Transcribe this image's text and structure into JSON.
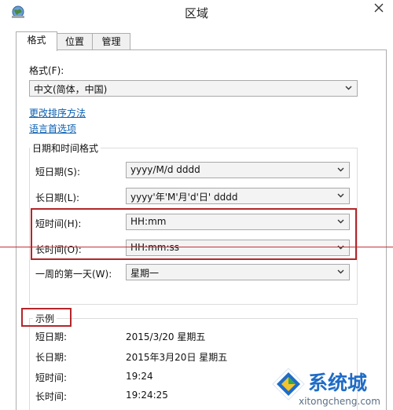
{
  "window": {
    "title": "区域"
  },
  "tabs": [
    {
      "label": "格式",
      "active": true
    },
    {
      "label": "位置",
      "active": false
    },
    {
      "label": "管理",
      "active": false
    }
  ],
  "format": {
    "label": "格式(F):",
    "value": "中文(简体，中国)"
  },
  "links": {
    "sort": "更改排序方法",
    "lang": "语言首选项"
  },
  "datetime": {
    "title": "日期和时间格式",
    "rows": [
      {
        "label": "短日期(S):",
        "value": "yyyy/M/d dddd"
      },
      {
        "label": "长日期(L):",
        "value": "yyyy'年'M'月'd'日' dddd"
      },
      {
        "label": "短时间(H):",
        "value": "HH:mm"
      },
      {
        "label": "长时间(O):",
        "value": "HH:mm:ss"
      },
      {
        "label": "一周的第一天(W):",
        "value": "星期一"
      }
    ]
  },
  "examples": {
    "title": "示例",
    "rows": [
      {
        "label": "短日期:",
        "value": "2015/3/20 星期五"
      },
      {
        "label": "长日期:",
        "value": "2015年3月20日 星期五"
      },
      {
        "label": "短时间:",
        "value": "19:24"
      },
      {
        "label": "长时间:",
        "value": "19:24:25"
      }
    ]
  },
  "watermark": {
    "text": "系统城",
    "url": "xitongcheng.com"
  },
  "colors": {
    "annotation_red": "#b3262a",
    "link_blue": "#0a5fb0",
    "watermark_blue": "#1f6cc6"
  }
}
